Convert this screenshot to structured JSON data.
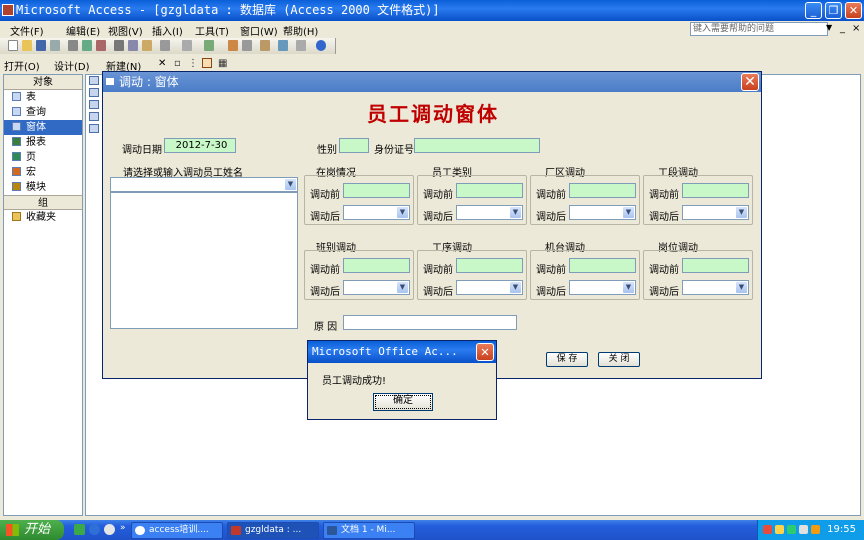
{
  "app": {
    "title": "Microsoft Access - [gzgldata : 数据库 (Access 2000 文件格式)]"
  },
  "menu": {
    "items": [
      "文件(F)",
      "编辑(E)",
      "视图(V)",
      "插入(I)",
      "工具(T)",
      "窗口(W)",
      "帮助(H)"
    ],
    "help_placeholder": "键入需要帮助的问题"
  },
  "db_toolbar": {
    "open": "打开(O)",
    "design": "设计(D)",
    "new": "新建(N)",
    "delete": "✕"
  },
  "db_nav": {
    "objects_header": "对象",
    "items": [
      "表",
      "查询",
      "窗体",
      "报表",
      "页",
      "宏",
      "模块"
    ],
    "selected_index": 2,
    "groups_header": "组",
    "favorites": "收藏夹"
  },
  "form": {
    "window_title": "调动 : 窗体",
    "heading": "员工调动窗体",
    "date_label": "调动日期",
    "date_value": "2012-7-30",
    "gender_label": "性别",
    "gender_value": "",
    "idcard_label": "身份证号",
    "idcard_value": "",
    "name_prompt": "请选择或输入调动员工姓名",
    "before_label": "调动前",
    "after_label": "调动后",
    "groups": [
      "在岗情况",
      "员工类别",
      "厂区调动",
      "工段调动",
      "班别调动",
      "工序调动",
      "机台调动",
      "岗位调动"
    ],
    "reason_label": "原 因",
    "reason_value": "",
    "save_label": "保 存",
    "close_label": "关 闭"
  },
  "msgbox": {
    "title": "Microsoft Office Ac...",
    "text": "员工调动成功!",
    "ok_label": "确定"
  },
  "taskbar": {
    "start_label": "开始",
    "tasks": [
      {
        "label": "access培训....",
        "active": false
      },
      {
        "label": "gzgldata : ...",
        "active": true
      },
      {
        "label": "文档 1 - Mi...",
        "active": false
      }
    ],
    "clock": "19:55"
  },
  "colors": {
    "field_green": "#C8F7C8",
    "heading_red": "#C00000",
    "title_blue": "#0A5FD8"
  }
}
